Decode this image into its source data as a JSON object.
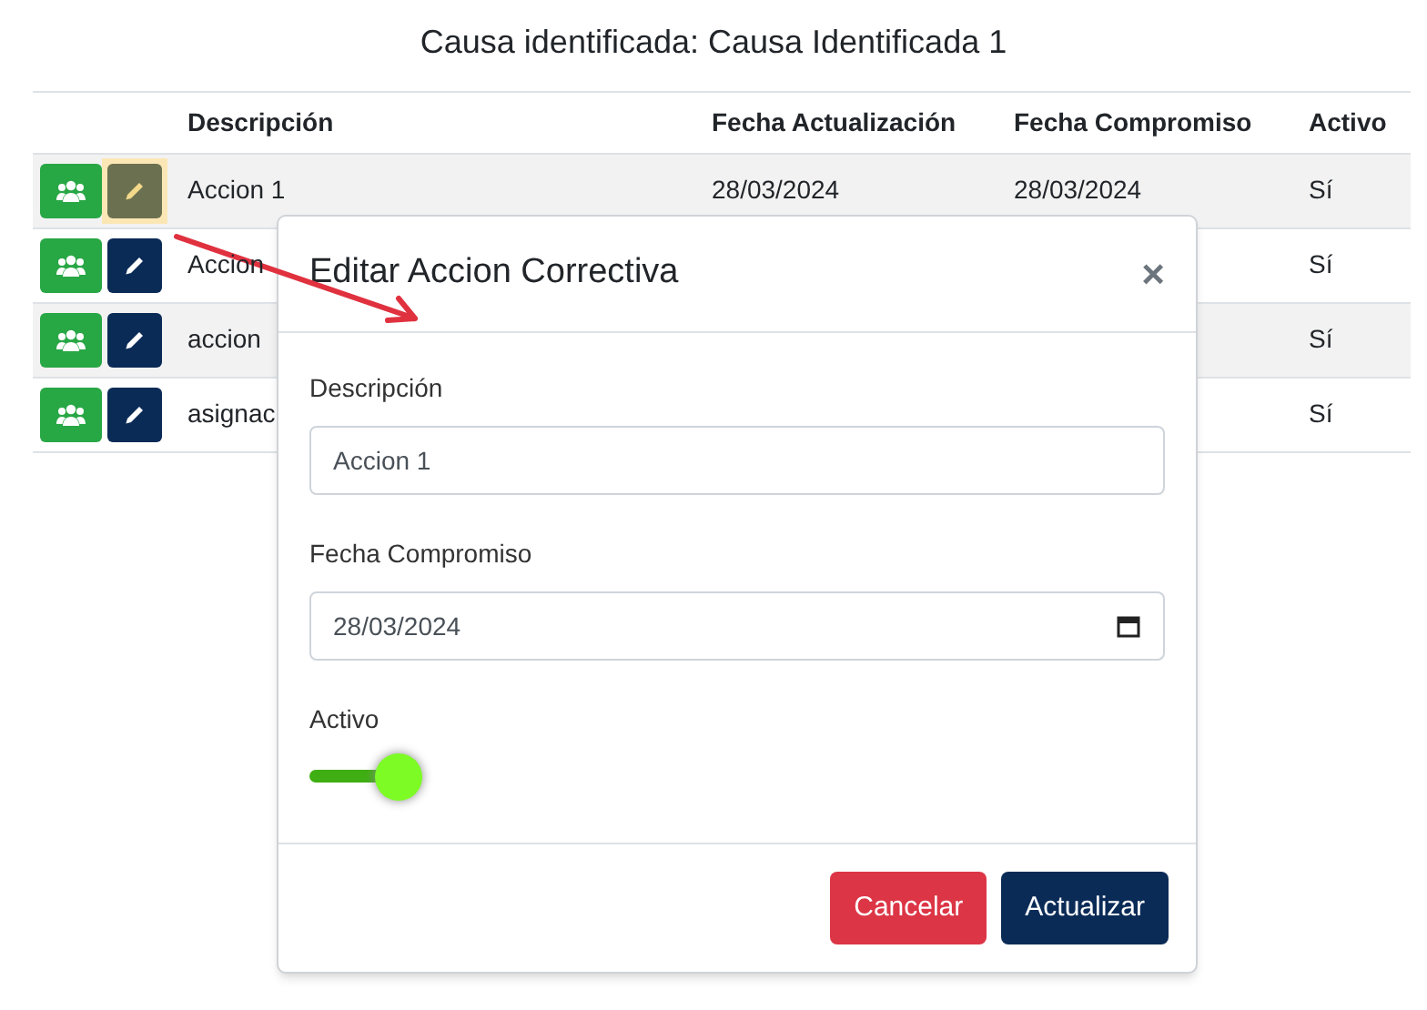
{
  "title": "Causa identificada: Causa Identificada 1",
  "table": {
    "columns": [
      "Descripción",
      "Fecha Actualización",
      "Fecha Compromiso",
      "Activo"
    ],
    "rows": [
      {
        "descripcion": "Accion 1",
        "fecha_actualizacion": "28/03/2024",
        "fecha_compromiso": "28/03/2024",
        "activo": "Sí",
        "edit_highlighted": true
      },
      {
        "descripcion": "Accion",
        "activo": "Sí",
        "edit_highlighted": false
      },
      {
        "descripcion": "accion",
        "activo": "Sí",
        "edit_highlighted": false
      },
      {
        "descripcion": "asignac",
        "activo": "Sí",
        "edit_highlighted": false
      }
    ]
  },
  "modal": {
    "title": "Editar Accion Correctiva",
    "close": "×",
    "fields": [
      {
        "kind": "text",
        "label": "Descripción",
        "value": "Accion 1"
      },
      {
        "kind": "date",
        "label": "Fecha Compromiso",
        "value": "28/03/2024"
      },
      {
        "kind": "toggle",
        "label": "Activo",
        "on": true
      }
    ],
    "buttons": [
      {
        "kind": "cancel",
        "label": "Cancelar"
      },
      {
        "kind": "primary",
        "label": "Actualizar"
      }
    ]
  }
}
